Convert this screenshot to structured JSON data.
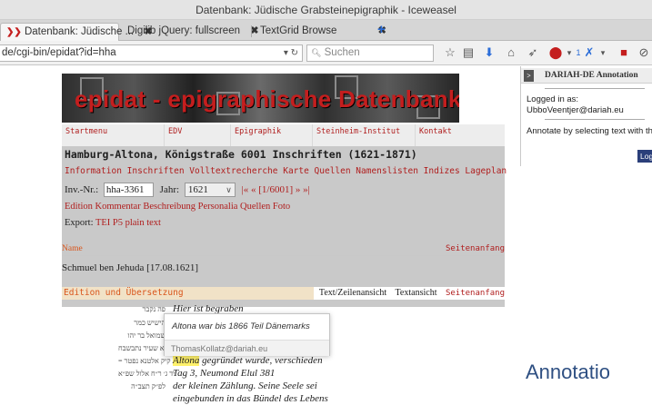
{
  "window": {
    "title": "Datenbank: Jüdische Grabsteinepigraphik - Iceweasel"
  },
  "tabs": [
    {
      "label": "Datenbank: Jüdische ...",
      "close": "✖",
      "icon": "epidat-favicon"
    },
    {
      "label": "Digilib jQuery: fullscreen",
      "close": "✖"
    },
    {
      "label": "TextGrid Browse",
      "close": "✖"
    }
  ],
  "navbar": {
    "url": "de/cgi-bin/epidat?id=hha",
    "search_placeholder": "Suchen",
    "new_tab": "+",
    "addon_count": "1"
  },
  "site": {
    "banner_title": "epidat - epigraphische Datenbank",
    "menu": [
      "Startmenu",
      "EDV",
      "Epigraphik",
      "Steinheim-Institut",
      "Kontakt"
    ],
    "location_heading": "Hamburg-Altona, Königstraße 6001 Inschriften (1621-1871)",
    "nav_links": "Information Inschriften Volltextrecherche Karte Quellen Namenslisten Indizes Lageplan",
    "inv_label": "Inv.-Nr.:",
    "inv_value": "hha-3361",
    "year_label": "Jahr:",
    "year_value": "1621",
    "pager": "|« « [1/6001] » »|",
    "sub_links": "Edition Kommentar Beschreibung Personalia Quellen Foto",
    "export_label": "Export:",
    "export_links": "TEI P5 plain text",
    "name_section": "Name",
    "seitenanfang": "Seitenanfang",
    "person_name": "Schmuel ben Jehuda [17.08.1621]",
    "edition_label": "Edition und Übersetzung",
    "view_line": "Text/Zeilenansicht",
    "view_text": "Textansicht",
    "hebrew_lines": [
      "פה נקבר",
      "הישיש כמר",
      "שמואל בר יהו",
      "דא שעיר נתבשבח",
      "= קיק אלטנא נפטר",
      "יד ג׳ ר״ח אלול שפ״א",
      "לפ״ק תצב״ה"
    ],
    "translation_lines": [
      "Hier ist begraben",
      "",
      "",
      "",
      "gegründet wurde, verschieden",
      "Tag 3, Neumond Elul 381",
      "der kleinen Zählung. Seine Seele sei",
      "eingebunden in das Bündel des Lebens"
    ],
    "highlight_word": "Altona"
  },
  "popup": {
    "text": "Altona war bis 1866 Teil Dänemarks",
    "user": "ThomasKollatz@dariah.eu"
  },
  "annotation_panel": {
    "toggle": ">",
    "title": "DARIAH-DE Annotation",
    "logged_in_label": "Logged in as:",
    "user": "UbboVeentjer@dariah.eu",
    "hint": "Annotate by selecting text with the m",
    "logout": "Log"
  },
  "overlay_text": "Annotatio",
  "colors": {
    "link_red": "#b01e1e",
    "orange": "#d9551b",
    "highlight": "#fff16b",
    "annot_btn": "#2b3f7a",
    "overlay_blue": "#2e4f82"
  }
}
